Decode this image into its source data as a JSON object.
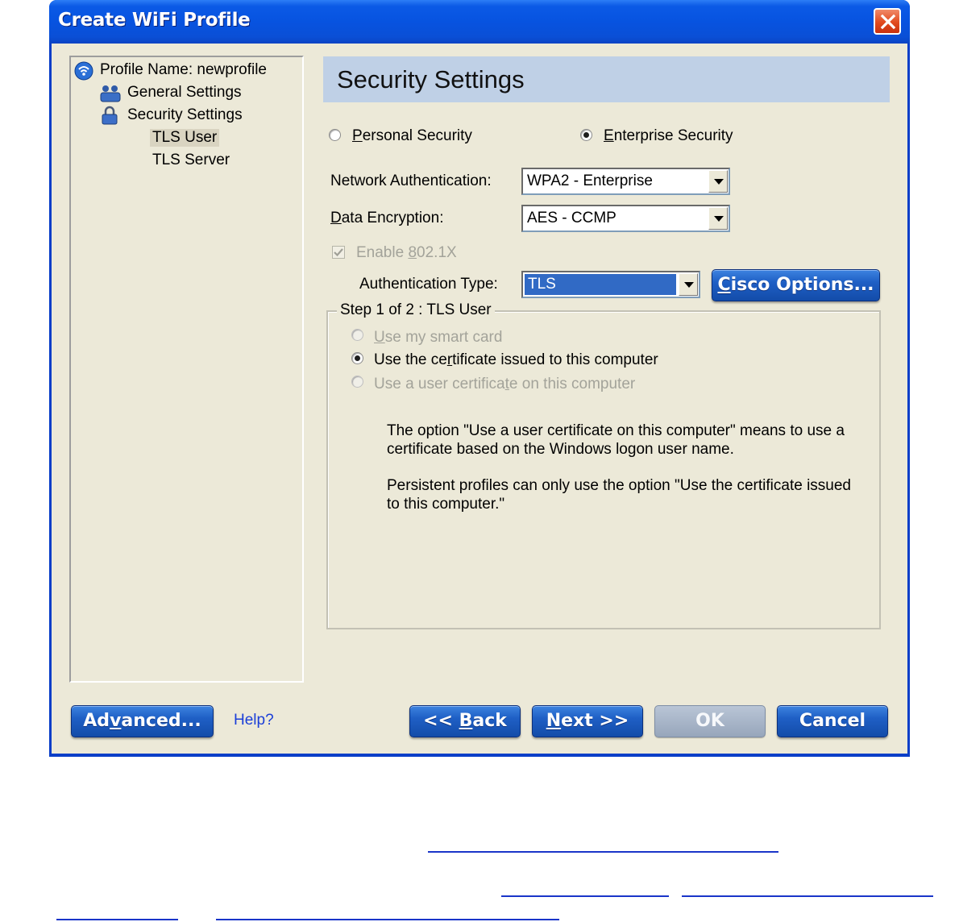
{
  "window": {
    "title": "Create WiFi Profile"
  },
  "tree": {
    "profile": "Profile Name: newprofile",
    "general": "General Settings",
    "security": "Security Settings",
    "tls_user": "TLS User",
    "tls_server": "TLS Server"
  },
  "header": {
    "title": "Security Settings"
  },
  "security_mode": {
    "personal": {
      "label_accel": "P",
      "label_rest": "ersonal Security",
      "selected": false
    },
    "enterprise": {
      "label_accel": "E",
      "label_rest": "nterprise Security",
      "selected": true
    }
  },
  "network_auth": {
    "label": "Network Authentication:",
    "value": "WPA2 - Enterprise"
  },
  "data_encryption": {
    "label_accel": "D",
    "label_rest": "ata Encryption:",
    "value": "AES - CCMP"
  },
  "enable_8021x": {
    "label_pre": "Enable ",
    "label_accel": "8",
    "label_rest": "02.1X",
    "checked": true,
    "disabled": true
  },
  "auth_type": {
    "label": "Authentication Type:",
    "value": "TLS"
  },
  "cisco_button": {
    "label_accel": "C",
    "label_rest": "isco Options..."
  },
  "step_group": {
    "title": "Step 1 of 2 : TLS User",
    "options": [
      {
        "pre": "",
        "accel": "U",
        "rest": "se my smart card",
        "selected": false,
        "disabled": true
      },
      {
        "pre": "Use the ce",
        "accel": "r",
        "rest": "tificate issued to this computer",
        "selected": true,
        "disabled": false
      },
      {
        "pre": "Use a user certifica",
        "accel": "t",
        "rest": "e on this computer",
        "selected": false,
        "disabled": true
      }
    ],
    "info1_line1": "The option \"Use a user certificate on this computer\" means to use a",
    "info1_line2": "certificate based on the Windows logon user name.",
    "info2_line1": "Persistent profiles can only use the option \"Use the certificate issued",
    "info2_line2": "to this computer.\""
  },
  "footer": {
    "advanced": {
      "pre": "Ad",
      "accel": "v",
      "rest": "anced..."
    },
    "help": "Help?",
    "back": {
      "pre": "<< ",
      "accel": "B",
      "rest": "ack"
    },
    "next": {
      "pre": "",
      "accel": "N",
      "rest": "ext >>"
    },
    "ok": "OK",
    "cancel": "Cancel"
  },
  "colors": {
    "title_bar": "#0b5ae6",
    "client_bg": "#ece9d8",
    "header_band": "#bfd0e6",
    "button_blue": "#1f5fc5",
    "link": "#1a3ed8"
  }
}
